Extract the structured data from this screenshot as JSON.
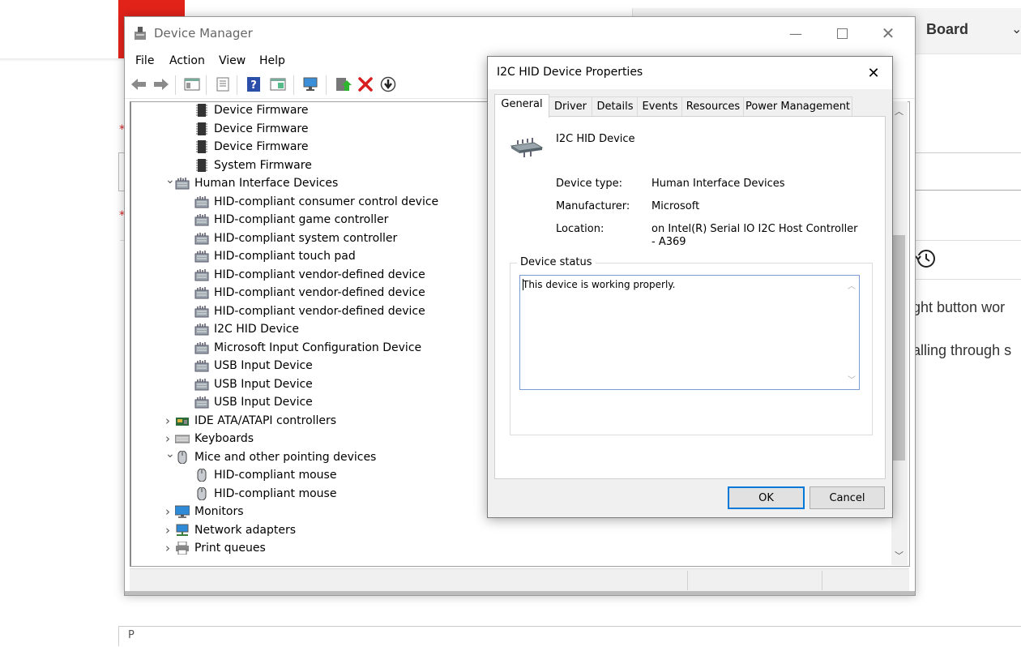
{
  "background_page": {
    "header_label": "Board",
    "text_line_1": "ght button wor",
    "text_line_2": "alling through s",
    "bottom_text": "P"
  },
  "device_manager": {
    "title": "Device Manager",
    "menu": [
      "File",
      "Action",
      "View",
      "Help"
    ],
    "tree": [
      {
        "label": "Device Firmware",
        "level": 2,
        "icon": "chip-icon"
      },
      {
        "label": "Device Firmware",
        "level": 2,
        "icon": "chip-icon"
      },
      {
        "label": "Device Firmware",
        "level": 2,
        "icon": "chip-icon"
      },
      {
        "label": "System Firmware",
        "level": 2,
        "icon": "chip-icon"
      },
      {
        "label": "Human Interface Devices",
        "level": 1,
        "icon": "hid-icon",
        "expander": "v"
      },
      {
        "label": "HID-compliant consumer control device",
        "level": 2,
        "icon": "hid-icon"
      },
      {
        "label": "HID-compliant game controller",
        "level": 2,
        "icon": "hid-icon"
      },
      {
        "label": "HID-compliant system controller",
        "level": 2,
        "icon": "hid-icon"
      },
      {
        "label": "HID-compliant touch pad",
        "level": 2,
        "icon": "hid-icon"
      },
      {
        "label": "HID-compliant vendor-defined device",
        "level": 2,
        "icon": "hid-icon"
      },
      {
        "label": "HID-compliant vendor-defined device",
        "level": 2,
        "icon": "hid-icon"
      },
      {
        "label": "HID-compliant vendor-defined device",
        "level": 2,
        "icon": "hid-icon"
      },
      {
        "label": "I2C HID Device",
        "level": 2,
        "icon": "hid-icon"
      },
      {
        "label": "Microsoft Input Configuration Device",
        "level": 2,
        "icon": "hid-icon"
      },
      {
        "label": "USB Input Device",
        "level": 2,
        "icon": "hid-icon"
      },
      {
        "label": "USB Input Device",
        "level": 2,
        "icon": "hid-icon"
      },
      {
        "label": "USB Input Device",
        "level": 2,
        "icon": "hid-icon"
      },
      {
        "label": "IDE ATA/ATAPI controllers",
        "level": 1,
        "icon": "ide-icon",
        "expander": ">"
      },
      {
        "label": "Keyboards",
        "level": 1,
        "icon": "keyboard-icon",
        "expander": ">"
      },
      {
        "label": "Mice and other pointing devices",
        "level": 1,
        "icon": "mouse-icon",
        "expander": "v"
      },
      {
        "label": "HID-compliant mouse",
        "level": 2,
        "icon": "mouse-icon"
      },
      {
        "label": "HID-compliant mouse",
        "level": 2,
        "icon": "mouse-icon"
      },
      {
        "label": "Monitors",
        "level": 1,
        "icon": "monitor-icon",
        "expander": ">"
      },
      {
        "label": "Network adapters",
        "level": 1,
        "icon": "network-icon",
        "expander": ">"
      },
      {
        "label": "Print queues",
        "level": 1,
        "icon": "printer-icon",
        "expander": ">"
      }
    ]
  },
  "dialog": {
    "title": "I2C HID Device Properties",
    "tabs": [
      "General",
      "Driver",
      "Details",
      "Events",
      "Resources",
      "Power Management"
    ],
    "active_tab": "General",
    "device_name": "I2C HID Device",
    "props": {
      "device_type_label": "Device type:",
      "device_type_value": "Human Interface Devices",
      "manufacturer_label": "Manufacturer:",
      "manufacturer_value": "Microsoft",
      "location_label": "Location:",
      "location_value": "on Intel(R) Serial IO I2C Host Controller - A369"
    },
    "status_group_label": "Device status",
    "status_text": "This device is working properly.",
    "ok_label": "OK",
    "cancel_label": "Cancel"
  },
  "colors": {
    "accent": "#0078d7",
    "background_red": "#e2231a",
    "delete_red": "#d81e1e"
  }
}
